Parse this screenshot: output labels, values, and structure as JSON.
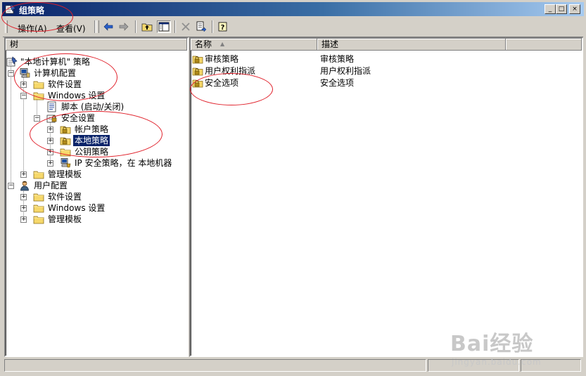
{
  "window": {
    "title": "组策略",
    "controls": {
      "minimize": "_",
      "maximize": "□",
      "close": "×"
    }
  },
  "menu": {
    "items": [
      {
        "label": "操作(A)"
      },
      {
        "label": "查看(V)"
      }
    ]
  },
  "toolbar": {
    "buttons": [
      {
        "icon": "back-arrow-icon"
      },
      {
        "icon": "forward-arrow-icon"
      },
      {
        "icon": "up-folder-icon"
      },
      {
        "icon": "show-hide-tree-icon"
      },
      {
        "icon": "delete-x-icon"
      },
      {
        "icon": "export-list-icon"
      },
      {
        "icon": "help-icon"
      }
    ]
  },
  "left_pane": {
    "header": "树",
    "tree": [
      {
        "label": "\"本地计算机\" 策略",
        "icon": "policy-root-icon"
      },
      {
        "label": "计算机配置",
        "icon": "computer-icon",
        "expander": "−"
      },
      {
        "label": "软件设置",
        "icon": "folder-icon",
        "expander": "+"
      },
      {
        "label": "Windows 设置",
        "icon": "folder-icon",
        "expander": "−"
      },
      {
        "label": "脚本 (启动/关闭)",
        "icon": "script-icon"
      },
      {
        "label": "安全设置",
        "icon": "security-settings-icon",
        "expander": "−"
      },
      {
        "label": "帐户策略",
        "icon": "locked-folder-icon",
        "expander": "+"
      },
      {
        "label": "本地策略",
        "icon": "locked-folder-icon",
        "expander": "+",
        "selected": true
      },
      {
        "label": "公钥策略",
        "icon": "folder-icon",
        "expander": "+"
      },
      {
        "label": "IP 安全策略，在 本地机器",
        "icon": "ip-security-icon",
        "expander": "+"
      },
      {
        "label": "管理模板",
        "icon": "folder-icon",
        "expander": "+"
      },
      {
        "label": "用户配置",
        "icon": "user-icon",
        "expander": "−"
      },
      {
        "label": "软件设置",
        "icon": "folder-icon",
        "expander": "+"
      },
      {
        "label": "Windows 设置",
        "icon": "folder-icon",
        "expander": "+"
      },
      {
        "label": "管理模板",
        "icon": "folder-icon",
        "expander": "+"
      }
    ]
  },
  "right_pane": {
    "columns": [
      {
        "label": "名称",
        "sort": "▲"
      },
      {
        "label": "描述"
      },
      {
        "label": ""
      }
    ],
    "rows": [
      {
        "name": "审核策略",
        "description": "审核策略",
        "icon": "locked-folder-icon"
      },
      {
        "name": "用户权利指派",
        "description": "用户权利指派",
        "icon": "locked-folder-icon"
      },
      {
        "name": "安全选项",
        "description": "安全选项",
        "icon": "locked-folder-icon"
      }
    ]
  },
  "watermark": {
    "brand": "Bai经验",
    "url": "jingyan.baidu.com"
  },
  "colors": {
    "title_start": "#0a246a",
    "title_end": "#a6caf0",
    "selection": "#0a246a",
    "chrome": "#d4d0c8",
    "annotation": "#e0202a"
  }
}
